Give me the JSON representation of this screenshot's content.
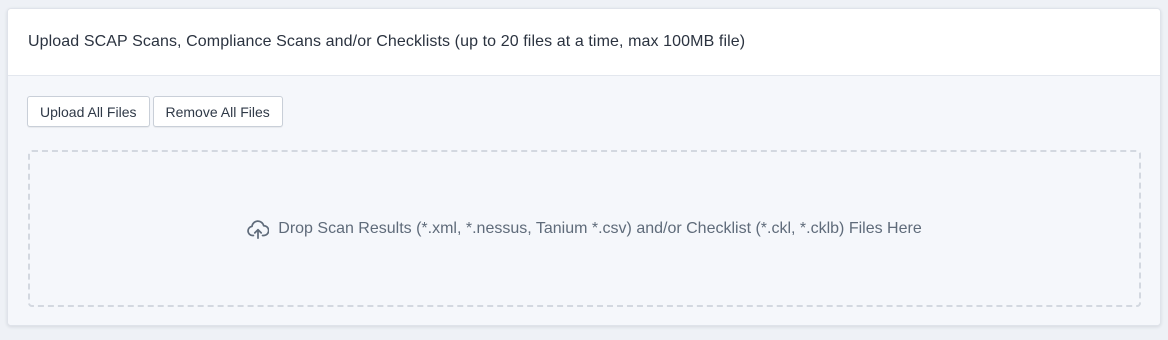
{
  "panel": {
    "title": "Upload SCAP Scans, Compliance Scans and/or Checklists (up to 20 files at a time, max 100MB file)"
  },
  "toolbar": {
    "upload_all_label": "Upload All Files",
    "remove_all_label": "Remove All Files"
  },
  "dropzone": {
    "icon": "cloud-upload-icon",
    "text": "Drop Scan Results (*.xml, *.nessus, Tanium *.csv) and/or Checklist (*.ckl, *.cklb) Files Here"
  },
  "colors": {
    "background": "#eef1f6",
    "card": "#ffffff",
    "body": "#f5f7fb",
    "dashed_border": "#d3d8e0",
    "text": "#2b3340"
  }
}
